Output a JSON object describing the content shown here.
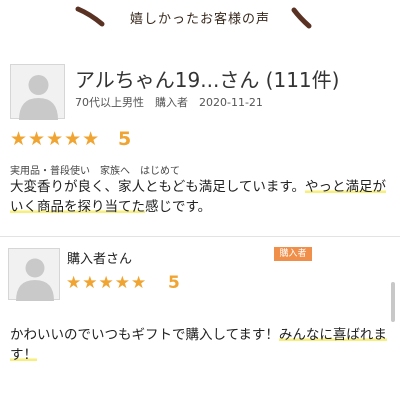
{
  "header": {
    "title": "嬉しかったお客様の声"
  },
  "reviews": [
    {
      "name": "アルちゃん19...さん (111件)",
      "meta": "70代以上男性　購入者　2020-11-21",
      "stars": "★★★★★",
      "score": "5",
      "tags": "実用品・普段使い　家族へ　はじめて",
      "text_a": "大変香りが良く、家人ともども満足しています。",
      "text_b": "やっと満足がいく商品を探り当てた",
      "text_c": "感じです。"
    },
    {
      "name": "購入者さん",
      "badge": "購入者",
      "stars": "★★★★★",
      "score": "5",
      "text_a": "かわいいのでいつもギフトで購入してます！",
      "text_b": "みんなに喜ばれます！"
    }
  ],
  "colors": {
    "star": "#f0a431",
    "badge": "#f08f4a",
    "highlight": "#f7ef7a",
    "header_text": "#3a2a1e"
  },
  "icons": [
    "avatar-placeholder-icon",
    "decorative-brush-stroke"
  ]
}
